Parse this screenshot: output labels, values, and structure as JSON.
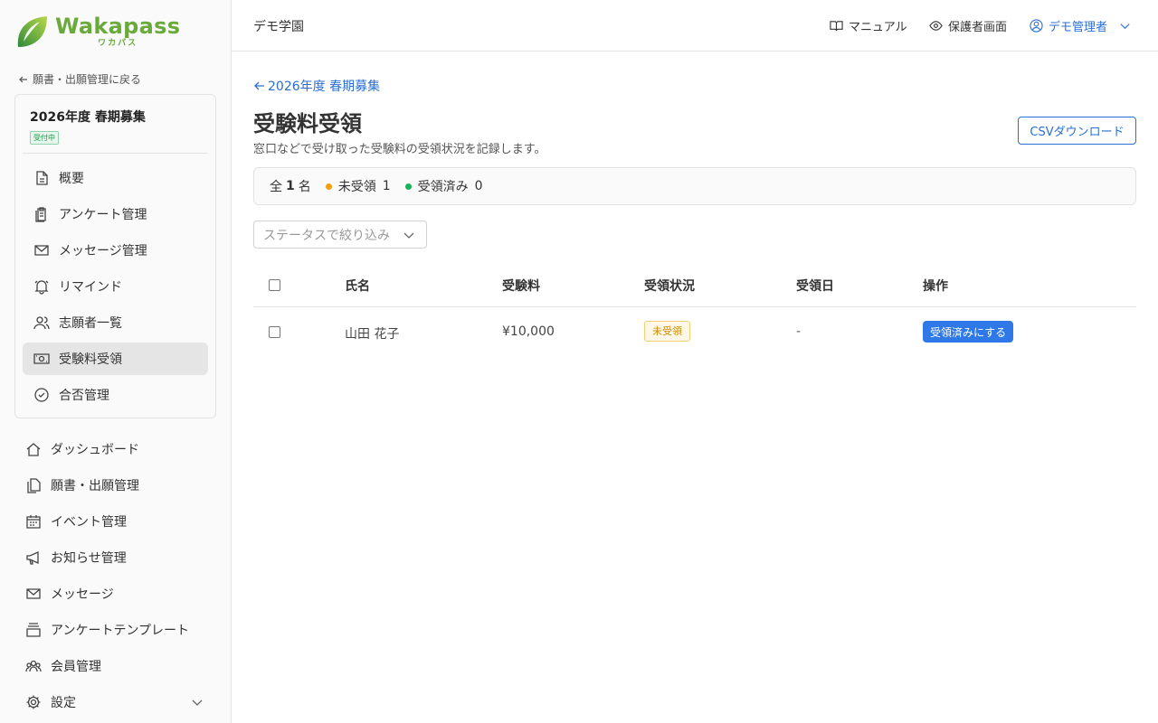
{
  "brand": {
    "name": "Wakapass",
    "sub": "ワカパス"
  },
  "sidebar": {
    "back_label": "願書・出願管理に戻る",
    "campaign": {
      "title": "2026年度 春期募集",
      "status": "受付中"
    },
    "campaign_items": [
      {
        "label": "概要",
        "icon": "document-icon"
      },
      {
        "label": "アンケート管理",
        "icon": "clipboard-icon"
      },
      {
        "label": "メッセージ管理",
        "icon": "mail-icon"
      },
      {
        "label": "リマインド",
        "icon": "bell-icon"
      },
      {
        "label": "志願者一覧",
        "icon": "users-icon"
      },
      {
        "label": "受験料受領",
        "icon": "cash-icon",
        "active": true
      },
      {
        "label": "合否管理",
        "icon": "check-circle-icon"
      }
    ],
    "main_items": [
      {
        "label": "ダッシュボード",
        "icon": "home-icon"
      },
      {
        "label": "願書・出願管理",
        "icon": "copy-icon"
      },
      {
        "label": "イベント管理",
        "icon": "calendar-icon"
      },
      {
        "label": "お知らせ管理",
        "icon": "megaphone-icon"
      },
      {
        "label": "メッセージ",
        "icon": "mail-icon"
      },
      {
        "label": "アンケートテンプレート",
        "icon": "stack-icon"
      },
      {
        "label": "会員管理",
        "icon": "group-icon"
      },
      {
        "label": "設定",
        "icon": "gear-icon"
      }
    ]
  },
  "header": {
    "school": "デモ学園",
    "manual": "マニュアル",
    "parent_view": "保護者画面",
    "user": "デモ管理者"
  },
  "main": {
    "breadcrumb": "2026年度 春期募集",
    "title": "受験料受領",
    "description": "窓口などで受け取った受験料の受領状況を記録します。",
    "csv_button": "CSVダウンロード",
    "summary": {
      "total_prefix": "全",
      "total_count": "1",
      "total_suffix": "名",
      "pending_label": "未受領",
      "pending_count": "1",
      "received_label": "受領済み",
      "received_count": "0",
      "pending_color": "#f59e0b",
      "received_color": "#16b35a"
    },
    "filter_placeholder": "ステータスで絞り込み",
    "table": {
      "headers": [
        "氏名",
        "受験料",
        "受領状況",
        "受領日",
        "操作"
      ],
      "rows": [
        {
          "name": "山田 花子",
          "fee": "¥10,000",
          "status": "未受領",
          "date": "-",
          "action": "受領済みにする"
        }
      ]
    }
  }
}
